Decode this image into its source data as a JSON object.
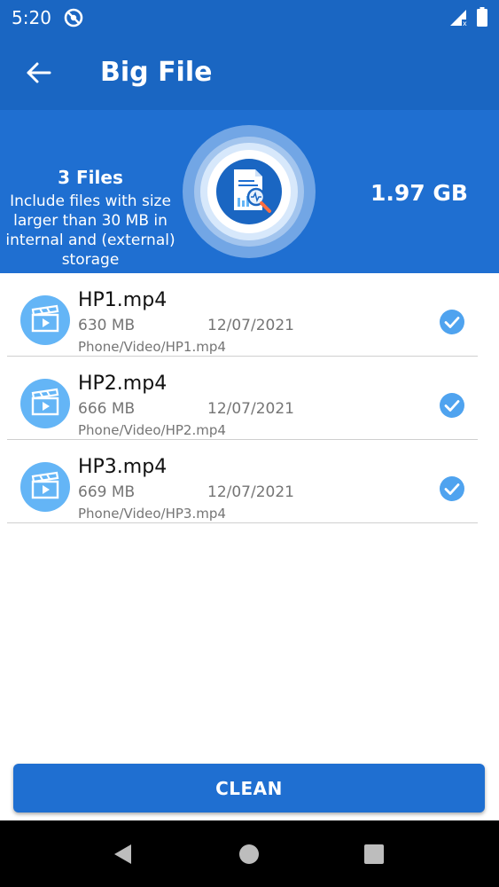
{
  "status_bar": {
    "time": "5:20",
    "icons": [
      "sync-icon",
      "signal-icon",
      "battery-icon"
    ]
  },
  "app_bar": {
    "back_icon": "arrow-left-icon",
    "title": "Big File"
  },
  "summary": {
    "file_count": "3 Files",
    "description": "Include files with size larger than 30 MB in internal and (external) storage",
    "total_size": "1.97 GB",
    "illustration_icon": "document-search-icon"
  },
  "files": [
    {
      "name": "HP1.mp4",
      "size": "630 MB",
      "date": "12/07/2021",
      "path": "Phone/Video/HP1.mp4",
      "checked": true
    },
    {
      "name": "HP2.mp4",
      "size": "666 MB",
      "date": "12/07/2021",
      "path": "Phone/Video/HP2.mp4",
      "checked": true
    },
    {
      "name": "HP3.mp4",
      "size": "669 MB",
      "date": "12/07/2021",
      "path": "Phone/Video/HP3.mp4",
      "checked": true
    }
  ],
  "clean_button": {
    "label": "CLEAN"
  },
  "nav_bar": {
    "icons": [
      "nav-back-icon",
      "nav-home-icon",
      "nav-recents-icon"
    ]
  },
  "colors": {
    "primary": "#1a66c2",
    "summary_bg": "#1f6fd1",
    "icon_circle": "#64b5f6",
    "check": "#4fa3ef"
  }
}
